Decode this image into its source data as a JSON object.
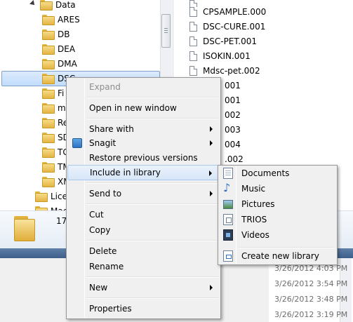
{
  "nav_tree": {
    "items": [
      {
        "label": "Data",
        "expanded": true
      },
      {
        "label": "ARES"
      },
      {
        "label": "DB"
      },
      {
        "label": "DEA"
      },
      {
        "label": "DMA"
      },
      {
        "label": "DSC",
        "selected": true
      },
      {
        "label": "Fi"
      },
      {
        "label": "m"
      },
      {
        "label": "Re"
      },
      {
        "label": "SD"
      },
      {
        "label": "TG"
      },
      {
        "label": "TM"
      },
      {
        "label": "XM"
      },
      {
        "label": "Lice"
      },
      {
        "label": "Mac"
      }
    ]
  },
  "file_list": {
    "items": [
      {
        "name": "CPSAMPLE.000"
      },
      {
        "name": "DSC-CURE.001"
      },
      {
        "name": "DSC-PET.001"
      },
      {
        "name": "ISOKIN.001"
      },
      {
        "name": "Mdsc-pet.002"
      },
      {
        "name": "001"
      },
      {
        "name": "001"
      },
      {
        "name": "002"
      },
      {
        "name": "003"
      },
      {
        "name": "004"
      },
      {
        "name": ".002"
      }
    ]
  },
  "details_pane": {
    "item_count_partial": "17"
  },
  "background_dates": [
    "3/26/2012 4:03 PM",
    "3/26/2012 3:54 PM",
    "3/26/2012 3:48 PM",
    "3/26/2012 3:19 PM"
  ],
  "context_menu": {
    "expand": "Expand",
    "open_new_window": "Open in new window",
    "share_with": "Share with",
    "snagit": "Snagit",
    "restore_versions": "Restore previous versions",
    "include_in_library": "Include in library",
    "send_to": "Send to",
    "cut": "Cut",
    "copy": "Copy",
    "delete": "Delete",
    "rename": "Rename",
    "new": "New",
    "properties": "Properties"
  },
  "library_submenu": {
    "documents": "Documents",
    "music": "Music",
    "pictures": "Pictures",
    "trios": "TRIOS",
    "videos": "Videos",
    "create_new_library": "Create new library"
  },
  "icons": {
    "folder": "folder-icon",
    "file": "file-icon",
    "snagit": "snagit-icon",
    "documents": "documents-library-icon",
    "music": "music-library-icon",
    "pictures": "pictures-library-icon",
    "videos": "videos-library-icon"
  },
  "colors": {
    "selection_fill": "#c1dcfc",
    "selection_border": "#7da2ce",
    "menu_background": "#f0f0f0",
    "folder": "#e3b444"
  }
}
